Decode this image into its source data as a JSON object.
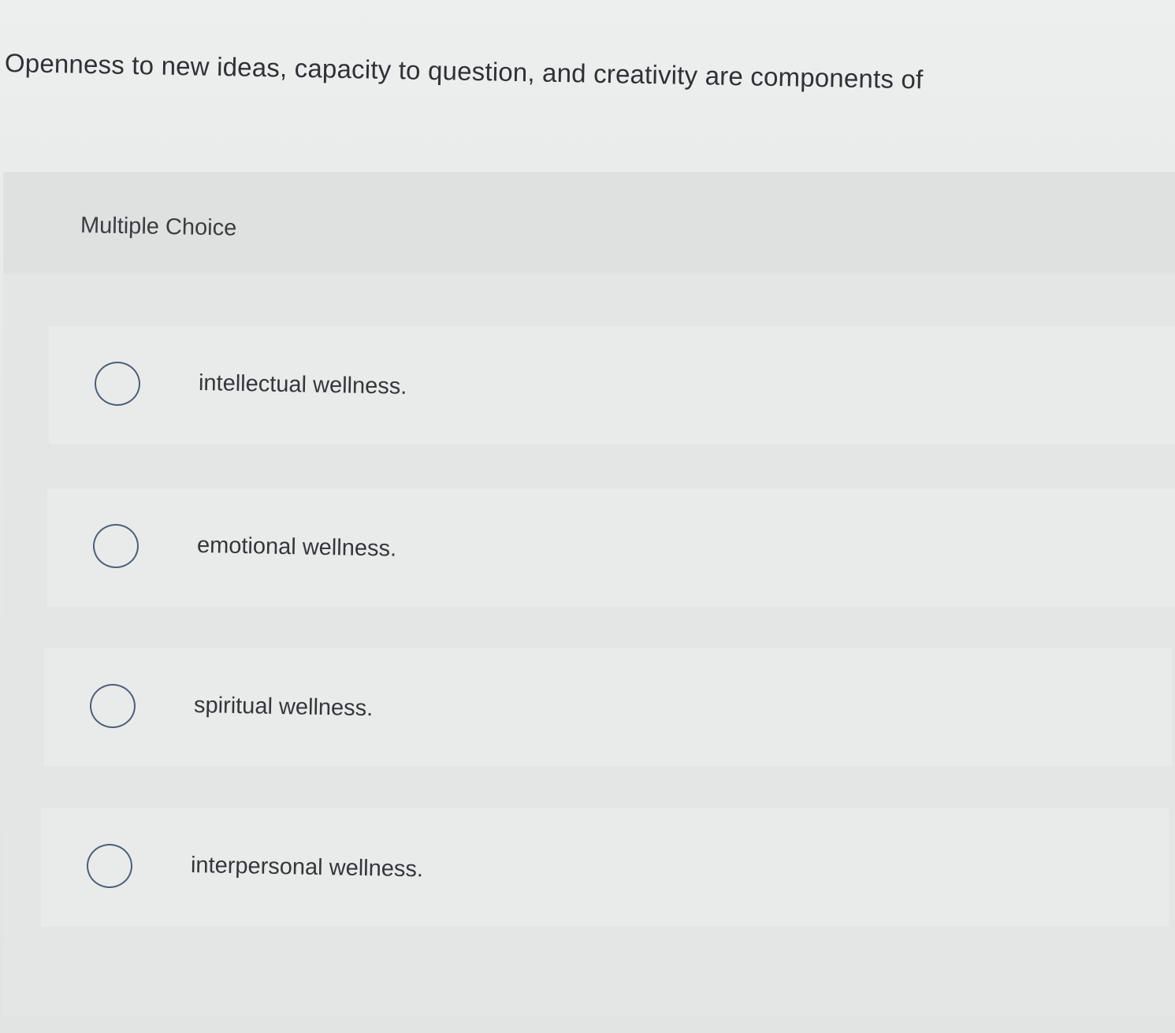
{
  "question": {
    "text": "Openness to new ideas, capacity to question, and creativity are components of"
  },
  "choice_type_label": "Multiple Choice",
  "options": [
    {
      "label": "intellectual wellness.",
      "selected": false
    },
    {
      "label": "emotional wellness.",
      "selected": false
    },
    {
      "label": "spiritual wellness.",
      "selected": false
    },
    {
      "label": "interpersonal wellness.",
      "selected": false
    }
  ],
  "colors": {
    "radio_border": "#4b5f78",
    "text": "#2f3135",
    "background": "#e7e9e8"
  }
}
